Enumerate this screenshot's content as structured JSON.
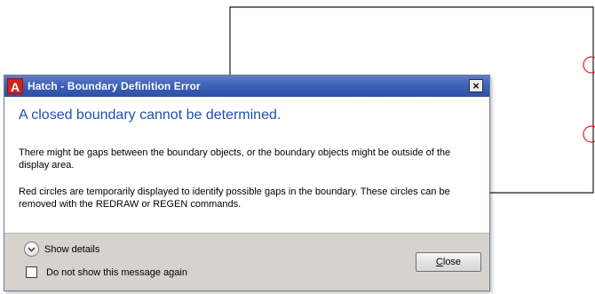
{
  "dialog": {
    "app_icon_letter": "A",
    "title": "Hatch - Boundary Definition Error",
    "close_glyph": "×",
    "main_instruction": "A closed boundary cannot be determined.",
    "paragraph_1": "There might be gaps between the boundary objects, or the boundary objects might be outside of the display area.",
    "paragraph_2": "Red circles are temporarily displayed to identify possible gaps in the boundary. These circles can be removed with the REDRAW or REGEN commands.",
    "show_details_label": "Show details",
    "checkbox_label": "Do not show this message again",
    "checkbox_checked": false,
    "close_button_access_key": "C",
    "close_button_rest": "lose"
  },
  "colors": {
    "title_bar": "#3c5fb8",
    "main_instruction": "#1e51b0",
    "footer": "#d6d3ce",
    "gap_marker": "#e02020",
    "app_icon": "#d22418"
  },
  "icons": {
    "app": "autocad-a-icon",
    "details": "chevron-down-icon",
    "gap_marker": "red-circle-marker"
  }
}
